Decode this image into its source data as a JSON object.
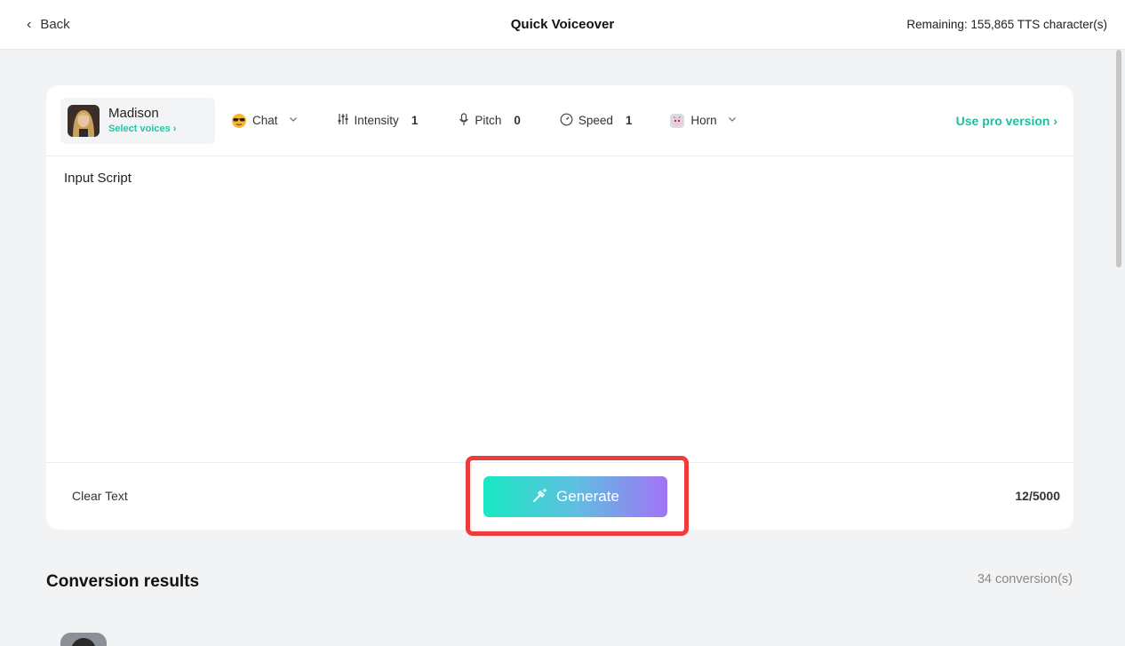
{
  "header": {
    "back_label": "Back",
    "title": "Quick Voiceover",
    "remaining": "Remaining: 155,865 TTS character(s)"
  },
  "toolbar": {
    "voice_name": "Madison",
    "select_voices": "Select voices ›",
    "style_label": "Chat",
    "intensity_label": "Intensity",
    "intensity_value": "1",
    "pitch_label": "Pitch",
    "pitch_value": "0",
    "speed_label": "Speed",
    "speed_value": "1",
    "bgm_label": "Horn",
    "pro_label": "Use pro version ›"
  },
  "script": {
    "value": "Input Script"
  },
  "footer": {
    "clear_label": "Clear Text",
    "generate_label": "Generate",
    "char_count": "12/5000"
  },
  "results": {
    "title": "Conversion results",
    "count": "34 conversion(s)"
  },
  "colors": {
    "accent": "#1cc9a8",
    "highlight": "#ee3b3b",
    "gradient_start": "#19e8c4",
    "gradient_end": "#a173f6"
  }
}
